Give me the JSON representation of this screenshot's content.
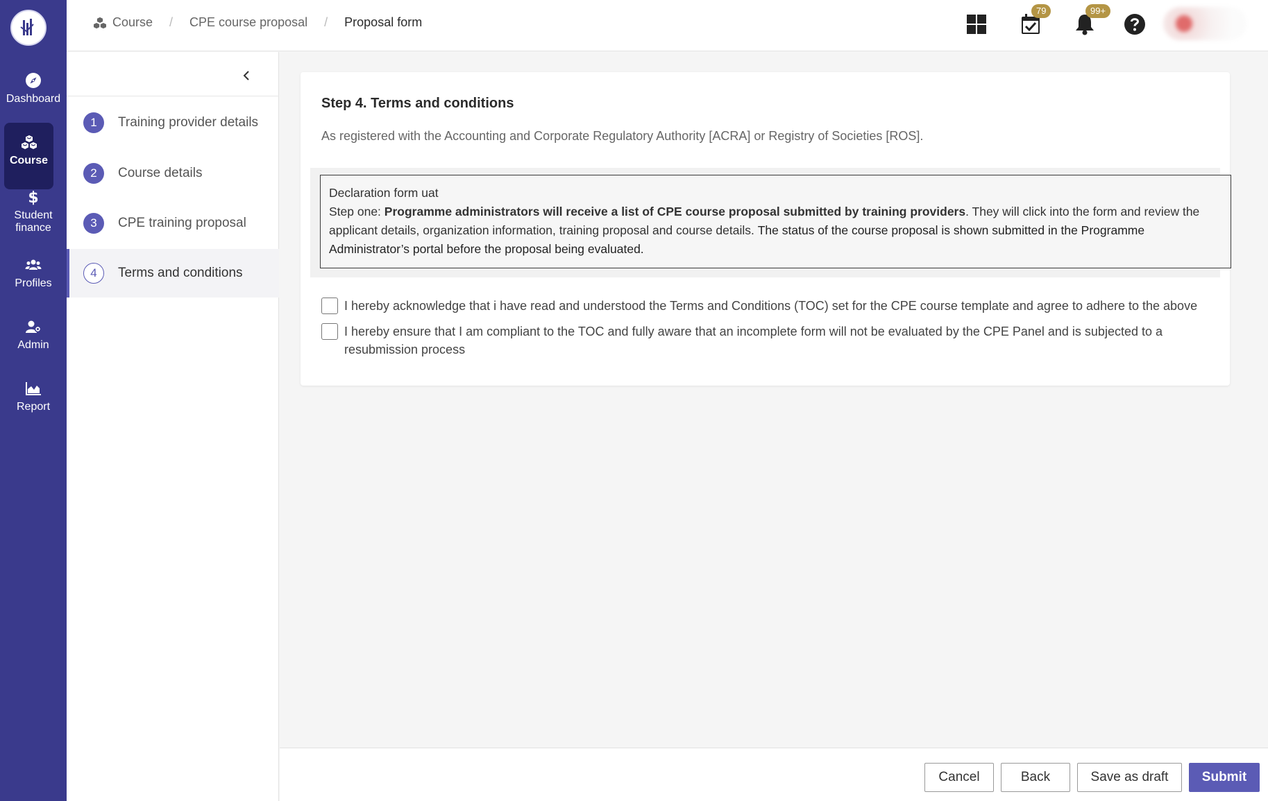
{
  "colors": {
    "nav_bg": "#3a3a8c",
    "accent": "#5b5bb5",
    "badge": "#b49545"
  },
  "nav": {
    "items": [
      {
        "label": "Dashboard",
        "icon": "compass-icon"
      },
      {
        "label": "Course",
        "icon": "course-cubes-icon",
        "active": true
      },
      {
        "label": "Student finance",
        "icon": "dollar-icon"
      },
      {
        "label": "Profiles",
        "icon": "users-icon"
      },
      {
        "label": "Admin",
        "icon": "user-gear-icon"
      },
      {
        "label": "Report",
        "icon": "area-chart-icon"
      }
    ]
  },
  "breadcrumb": {
    "items": [
      "Course",
      "CPE course proposal",
      "Proposal form"
    ]
  },
  "header": {
    "tasks_badge": "79",
    "notifications_badge": "99+"
  },
  "steps": {
    "items": [
      {
        "num": "1",
        "label": "Training provider details"
      },
      {
        "num": "2",
        "label": "Course details"
      },
      {
        "num": "3",
        "label": "CPE training proposal"
      },
      {
        "num": "4",
        "label": "Terms and conditions",
        "active": true
      }
    ]
  },
  "main": {
    "title": "Step 4. Terms and conditions",
    "subtitle": "As registered with the Accounting and Corporate Regulatory Authority [ACRA] or Registry of Societies [ROS].",
    "declaration": {
      "title": "Declaration form uat",
      "prefix": "Step one: ",
      "bold": "Programme administrators will receive a list of CPE course proposal submitted by training providers",
      "middle": ". They will click into the form and review the applicant details, organization information, training proposal and course details. ",
      "tail": "The status of the course proposal is shown submitted in the Programme Administrator’s portal before the proposal being evaluated."
    },
    "checkboxes": [
      {
        "label": "I hereby acknowledge that i have read and understood the Terms and Conditions (TOC) set for the CPE course template and agree to adhere to the above",
        "checked": false
      },
      {
        "label": "I hereby ensure that I am compliant to the TOC and fully aware that an incomplete form will not be evaluated by the CPE Panel and is subjected to a resubmission process",
        "checked": false
      }
    ]
  },
  "footer": {
    "cancel": "Cancel",
    "back": "Back",
    "save_draft": "Save as draft",
    "submit": "Submit"
  }
}
